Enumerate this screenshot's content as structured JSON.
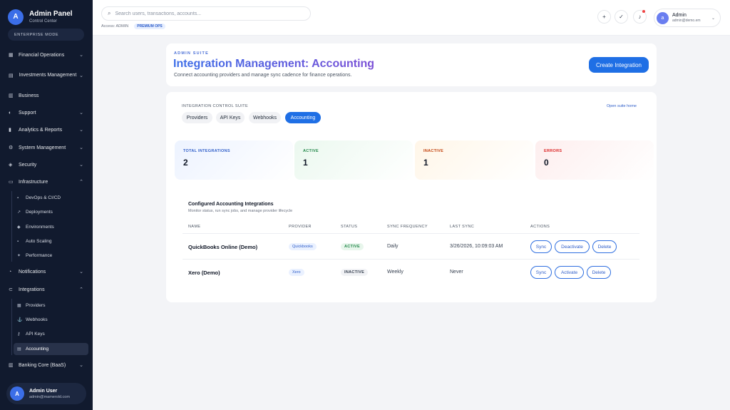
{
  "brand": {
    "logo_letter": "A",
    "title": "Admin Panel",
    "subtitle": "Control Center",
    "mode": "ENTERPRISE MODE"
  },
  "sidebar": {
    "items": [
      {
        "label": "Financial Operations",
        "icon": "bank-icon"
      },
      {
        "label": "Investments Management",
        "icon": "chart-icon"
      },
      {
        "label": "Business",
        "icon": "building-icon"
      },
      {
        "label": "Support",
        "icon": "headset-icon"
      },
      {
        "label": "Analytics & Reports",
        "icon": "bar-chart-icon"
      },
      {
        "label": "System Management",
        "icon": "cog-icon"
      },
      {
        "label": "Security",
        "icon": "shield-icon"
      },
      {
        "label": "Infrastructure",
        "icon": "server-icon"
      },
      {
        "label": "Notifications",
        "icon": "bell-icon"
      },
      {
        "label": "Integrations",
        "icon": "plug-icon"
      },
      {
        "label": "Banking Core (BaaS)",
        "icon": "bank-icon"
      }
    ],
    "infrastructure_sub": [
      {
        "label": "DevOps & CI/CD"
      },
      {
        "label": "Deployments"
      },
      {
        "label": "Environments"
      },
      {
        "label": "Auto Scaling"
      },
      {
        "label": "Performance"
      }
    ],
    "integrations_sub": [
      {
        "label": "Providers"
      },
      {
        "label": "Webhooks"
      },
      {
        "label": "API Keys"
      },
      {
        "label": "Accounting"
      }
    ]
  },
  "user": {
    "avatar_letter": "A",
    "name": "Admin User",
    "email": "admin@mamerold.com"
  },
  "topbar": {
    "search_placeholder": "Search users, transactions, accounts...",
    "access_text": "Access: ADMIN",
    "access_badge": "PREMIUM OPS",
    "admin_avatar": "a",
    "admin_name": "Admin",
    "admin_email": "admin@demo.em"
  },
  "header": {
    "eyebrow": "ADMIN SUITE",
    "title": "Integration Management: Accounting",
    "description": "Connect accounting providers and manage sync cadence for finance operations.",
    "create_button": "Create Integration"
  },
  "suite": {
    "label": "INTEGRATION CONTROL SUITE",
    "link": "Open suite home",
    "tabs": [
      {
        "label": "Providers"
      },
      {
        "label": "API Keys"
      },
      {
        "label": "Webhooks"
      },
      {
        "label": "Accounting"
      }
    ],
    "active_tab": "Accounting"
  },
  "stats": [
    {
      "label": "TOTAL INTEGRATIONS",
      "value": "2",
      "color": "#2f5ec9"
    },
    {
      "label": "ACTIVE",
      "value": "1",
      "color": "#23884a"
    },
    {
      "label": "INACTIVE",
      "value": "1",
      "color": "#c2410c"
    },
    {
      "label": "ERRORS",
      "value": "0",
      "color": "#dc2626"
    }
  ],
  "table": {
    "title": "Configured Accounting Integrations",
    "subtitle": "Monitor status, run sync jobs, and manage provider lifecycle",
    "columns": [
      "NAME",
      "PROVIDER",
      "STATUS",
      "SYNC FREQUENCY",
      "LAST SYNC",
      "ACTIONS"
    ],
    "rows": [
      {
        "name": "QuickBooks Online (Demo)",
        "provider": "Quickbooks",
        "status": "ACTIVE",
        "frequency": "Daily",
        "last_sync": "3/26/2026, 10:09:03 AM",
        "actions": [
          "Sync",
          "Deactivate",
          "Delete"
        ]
      },
      {
        "name": "Xero (Demo)",
        "provider": "Xero",
        "status": "INACTIVE",
        "frequency": "Weekly",
        "last_sync": "Never",
        "actions": [
          "Sync",
          "Activate",
          "Delete"
        ]
      }
    ]
  },
  "colors": {
    "sidebar_bg": "#111a2e",
    "accent": "#1f6fe5",
    "page_bg": "#f3f4f7"
  }
}
